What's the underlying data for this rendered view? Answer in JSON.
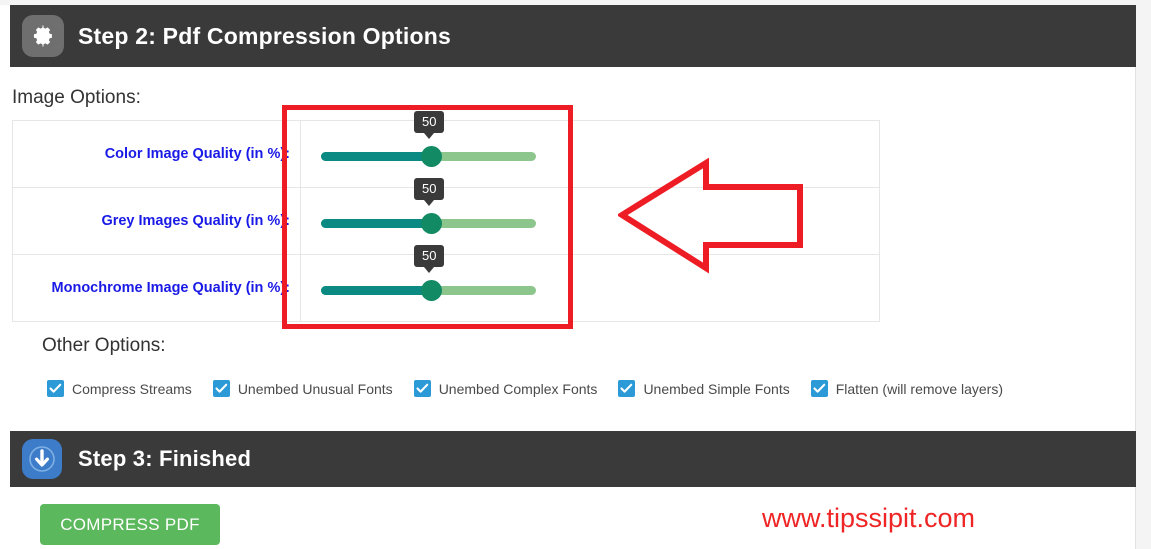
{
  "step2": {
    "title": "Step 2: Pdf Compression Options",
    "icon": "gear-icon"
  },
  "step3": {
    "title": "Step 3: Finished",
    "icon": "download-icon"
  },
  "image_options": {
    "heading": "Image Options:",
    "sliders": [
      {
        "label": "Color Image Quality (in %):",
        "value": "50"
      },
      {
        "label": "Grey Images Quality (in %):",
        "value": "50"
      },
      {
        "label": "Monochrome Image Quality (in %):",
        "value": "50"
      }
    ]
  },
  "other_options": {
    "heading": "Other Options:",
    "checkboxes": [
      {
        "label": "Compress Streams",
        "checked": true
      },
      {
        "label": "Unembed Unusual Fonts",
        "checked": true
      },
      {
        "label": "Unembed Complex Fonts",
        "checked": true
      },
      {
        "label": "Unembed Simple Fonts",
        "checked": true
      },
      {
        "label": "Flatten (will remove layers)",
        "checked": true
      }
    ]
  },
  "actions": {
    "compress_label": "COMPRESS PDF"
  },
  "watermark": {
    "text": "www.tipssipit.com"
  },
  "annotations": {
    "box_color": "#ee1c24",
    "arrow_color": "#ee1c24",
    "arrow_direction": "left"
  },
  "colors": {
    "header_bg": "#3a3a3a",
    "slider_fill": "#0b8a84",
    "slider_track": "#8dc68d",
    "slider_handle": "#128a63",
    "checkbox": "#2b9ad6",
    "button_green": "#5cb85c",
    "label_blue": "#1a1ae6"
  }
}
